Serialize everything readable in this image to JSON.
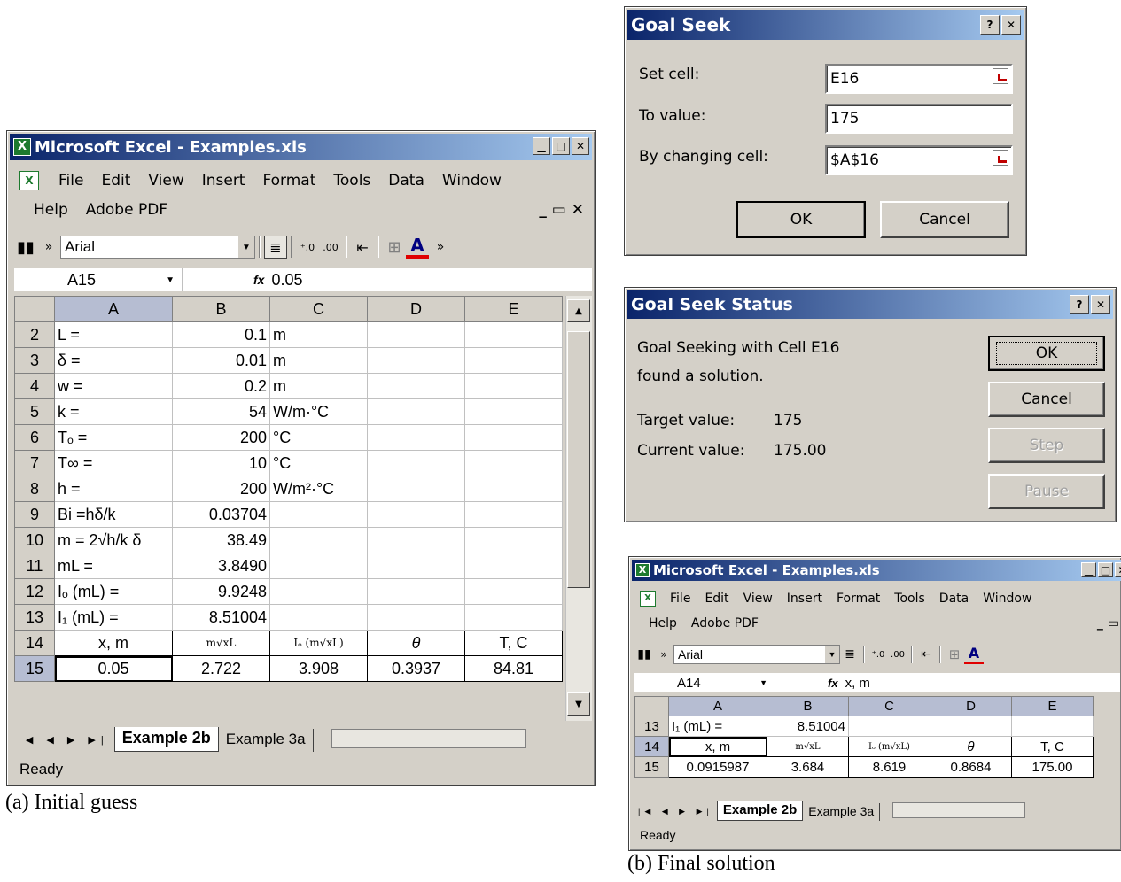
{
  "excel_a": {
    "title": "Microsoft Excel - Examples.xls",
    "menu": [
      "File",
      "Edit",
      "View",
      "Insert",
      "Format",
      "Tools",
      "Data",
      "Window"
    ],
    "menu2": [
      "Help",
      "Adobe PDF"
    ],
    "font_name": "Arial",
    "name_box": "A15",
    "formula": "0.05",
    "col_headers": [
      "A",
      "B",
      "C",
      "D",
      "E"
    ],
    "rows": [
      {
        "n": "2",
        "a": "L =",
        "b": "0.1",
        "c": "m",
        "d": "",
        "e": ""
      },
      {
        "n": "3",
        "a": "δ =",
        "b": "0.01",
        "c": "m",
        "d": "",
        "e": ""
      },
      {
        "n": "4",
        "a": "w =",
        "b": "0.2",
        "c": "m",
        "d": "",
        "e": ""
      },
      {
        "n": "5",
        "a": "k =",
        "b": "54",
        "c": "W/m·°C",
        "d": "",
        "e": ""
      },
      {
        "n": "6",
        "a": "Tₒ =",
        "b": "200",
        "c": "°C",
        "d": "",
        "e": ""
      },
      {
        "n": "7",
        "a": "T∞ =",
        "b": "10",
        "c": "°C",
        "d": "",
        "e": ""
      },
      {
        "n": "8",
        "a": "h =",
        "b": "200",
        "c": "W/m²·°C",
        "d": "",
        "e": ""
      },
      {
        "n": "9",
        "a": "Bi =hδ/k",
        "b": "0.03704",
        "c": "",
        "d": "",
        "e": ""
      },
      {
        "n": "10",
        "a": "m = 2√h/k δ",
        "b": "38.49",
        "c": "",
        "d": "",
        "e": ""
      },
      {
        "n": "11",
        "a": "mL =",
        "b": "3.8490",
        "c": "",
        "d": "",
        "e": ""
      },
      {
        "n": "12",
        "a": "Iₒ (mL) =",
        "b": "9.9248",
        "c": "",
        "d": "",
        "e": ""
      },
      {
        "n": "13",
        "a": "I₁ (mL) =",
        "b": "8.51004",
        "c": "",
        "d": "",
        "e": ""
      },
      {
        "n": "14",
        "a": "x, m",
        "b": "m√xL",
        "c": "Iₒ (m√xL)",
        "d": "θ",
        "e": "T, C"
      },
      {
        "n": "15",
        "a": "0.05",
        "b": "2.722",
        "c": "3.908",
        "d": "0.3937",
        "e": "84.81"
      }
    ],
    "sheet_tabs": [
      "Example 2b",
      "Example 3a"
    ],
    "status": "Ready",
    "caption": "(a) Initial guess"
  },
  "goal_seek": {
    "title": "Goal Seek",
    "set_cell_label": "Set cell:",
    "set_cell_value": "E16",
    "to_value_label": "To value:",
    "to_value_value": "175",
    "changing_label": "By changing cell:",
    "changing_value": "$A$16",
    "ok": "OK",
    "cancel": "Cancel"
  },
  "goal_status": {
    "title": "Goal Seek Status",
    "line1": "Goal Seeking with Cell E16",
    "line2": "found a solution.",
    "target_label": "Target value:",
    "target_value": "175",
    "current_label": "Current value:",
    "current_value": "175.00",
    "ok": "OK",
    "cancel": "Cancel",
    "step": "Step",
    "pause": "Pause"
  },
  "excel_b": {
    "title": "Microsoft Excel - Examples.xls",
    "menu": [
      "File",
      "Edit",
      "View",
      "Insert",
      "Format",
      "Tools",
      "Data",
      "Window"
    ],
    "menu2": [
      "Help",
      "Adobe PDF"
    ],
    "font_name": "Arial",
    "name_box": "A14",
    "formula": "x, m",
    "col_headers": [
      "A",
      "B",
      "C",
      "D",
      "E"
    ],
    "rows": [
      {
        "n": "13",
        "a": "I₁ (mL) =",
        "b": "8.51004",
        "c": "",
        "d": "",
        "e": ""
      },
      {
        "n": "14",
        "a": "x, m",
        "b": "m√xL",
        "c": "Iₒ (m√xL)",
        "d": "θ",
        "e": "T, C"
      },
      {
        "n": "15",
        "a": "0.0915987",
        "b": "3.684",
        "c": "8.619",
        "d": "0.8684",
        "e": "175.00"
      }
    ],
    "sheet_tabs": [
      "Example 2b",
      "Example 3a"
    ],
    "status": "Ready",
    "caption": "(b) Final solution"
  },
  "colors": {
    "title_start": "#0a246a",
    "title_end": "#a6caf0",
    "face": "#d4d0c8"
  },
  "icons": [
    "excel-app-icon",
    "chart-icon",
    "align-icon",
    "increase-decimal-icon",
    "decrease-decimal-icon",
    "indent-icon",
    "borders-icon",
    "font-color-icon",
    "help-icon",
    "close-icon",
    "minimize-icon",
    "maximize-icon",
    "range-ref-icon",
    "fx-icon"
  ]
}
